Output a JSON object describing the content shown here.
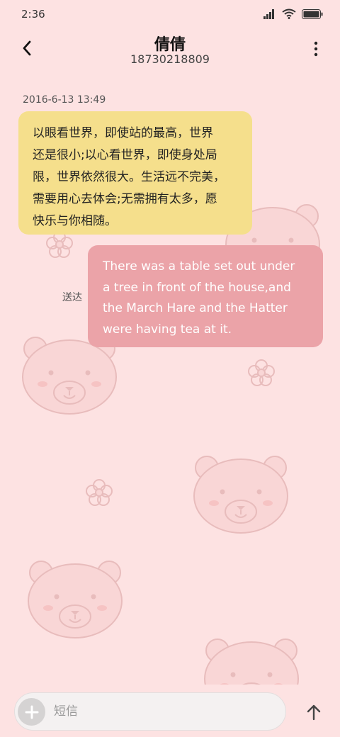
{
  "status_bar": {
    "time": "2:36"
  },
  "header": {
    "contact_name": "倩倩",
    "contact_number": "18730218809"
  },
  "messages": [
    {
      "direction": "received",
      "timestamp": "2016-6-13 13:49",
      "lines": [
        "以眼看世界，即使站的最高，世界",
        "还是很小;以心看世界，即使身处局",
        "限，世界依然很大。生活远不完美，",
        "需要用心去体会;无需拥有太多，愿",
        "快乐与你相随。"
      ]
    },
    {
      "direction": "sent",
      "status": "送达",
      "lines": [
        "There was a table set out under",
        "a tree in front of the house,and",
        "the March Hare and the Hatter",
        "were having tea at it."
      ]
    }
  ],
  "composer": {
    "placeholder": "短信"
  },
  "icons": {
    "back": "chevron-left-icon",
    "menu": "more-vertical-icon",
    "add": "plus-icon",
    "send": "arrow-up-icon"
  },
  "colors": {
    "background": "#fde2e2",
    "received_bubble": "#f5df8c",
    "sent_bubble": "#eba3a8"
  }
}
